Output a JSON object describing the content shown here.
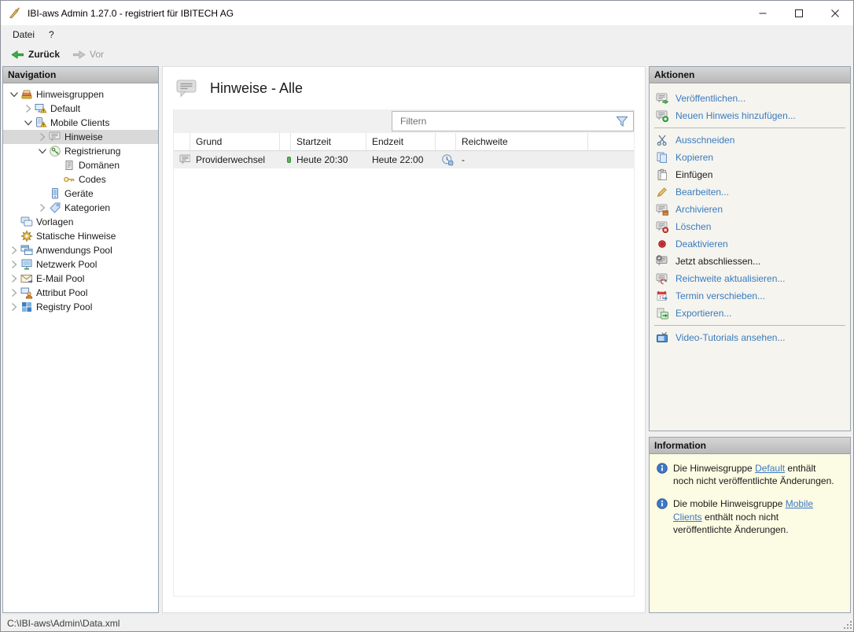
{
  "window": {
    "title": "IBI-aws Admin 1.27.0 - registriert für IBITECH AG",
    "app_icon": "hand-pen-icon",
    "controls": [
      {
        "name": "minimize-button",
        "icon": "minimize-icon"
      },
      {
        "name": "maximize-button",
        "icon": "maximize-icon"
      },
      {
        "name": "close-button",
        "icon": "close-icon"
      }
    ]
  },
  "menu": {
    "items": [
      {
        "label": "Datei"
      },
      {
        "label": "?"
      }
    ]
  },
  "toolbar": {
    "buttons": [
      {
        "label": "Zurück",
        "icon": "back-arrow-icon",
        "enabled": true
      },
      {
        "label": "Vor",
        "icon": "forward-arrow-icon",
        "enabled": false
      }
    ]
  },
  "navigation": {
    "header": "Navigation",
    "tree": [
      {
        "label": "Hinweisgruppen",
        "level": 0,
        "expander": "expanded",
        "icon": "hinweisgruppen",
        "selected": false
      },
      {
        "label": "Default",
        "level": 1,
        "expander": "collapsed",
        "icon": "default-group",
        "selected": false
      },
      {
        "label": "Mobile Clients",
        "level": 1,
        "expander": "expanded",
        "icon": "mobile-clients",
        "selected": false
      },
      {
        "label": "Hinweise",
        "level": 2,
        "expander": "collapsed",
        "icon": "hinweise",
        "selected": true
      },
      {
        "label": "Registrierung",
        "level": 2,
        "expander": "expanded",
        "icon": "registrierung",
        "selected": false
      },
      {
        "label": "Domänen",
        "level": 3,
        "expander": "none",
        "icon": "domaenen",
        "selected": false
      },
      {
        "label": "Codes",
        "level": 3,
        "expander": "none",
        "icon": "codes",
        "selected": false
      },
      {
        "label": "Geräte",
        "level": 2,
        "expander": "none",
        "icon": "geraete",
        "selected": false
      },
      {
        "label": "Kategorien",
        "level": 2,
        "expander": "collapsed",
        "icon": "kategorien",
        "selected": false
      },
      {
        "label": "Vorlagen",
        "level": 0,
        "expander": "none",
        "icon": "vorlagen",
        "selected": false
      },
      {
        "label": "Statische Hinweise",
        "level": 0,
        "expander": "none",
        "icon": "statische-hinweise",
        "selected": false
      },
      {
        "label": "Anwendungs Pool",
        "level": 0,
        "expander": "collapsed",
        "icon": "anwendungs-pool",
        "selected": false
      },
      {
        "label": "Netzwerk Pool",
        "level": 0,
        "expander": "collapsed",
        "icon": "netzwerk-pool",
        "selected": false
      },
      {
        "label": "E-Mail Pool",
        "level": 0,
        "expander": "collapsed",
        "icon": "email-pool",
        "selected": false
      },
      {
        "label": "Attribut Pool",
        "level": 0,
        "expander": "collapsed",
        "icon": "attribut-pool",
        "selected": false
      },
      {
        "label": "Registry Pool",
        "level": 0,
        "expander": "collapsed",
        "icon": "registry-pool",
        "selected": false
      }
    ]
  },
  "main": {
    "title": "Hinweise - Alle",
    "title_icon": "hinweis-bubble-icon",
    "filter": {
      "placeholder": "Filtern",
      "icon": "funnel-icon"
    },
    "table": {
      "columns": [
        "",
        "Grund",
        "",
        "Startzeit",
        "Endzeit",
        "",
        "Reichweite",
        ""
      ],
      "rows": [
        {
          "icon": "hinweise",
          "grund": "Providerwechsel",
          "status": "active",
          "status_color": "#57b457",
          "startzeit": "Heute 20:30",
          "endzeit": "Heute 22:00",
          "reach_icon": "clock-pending-icon",
          "reichweite": "-"
        }
      ]
    }
  },
  "actions": {
    "header": "Aktionen",
    "items": [
      {
        "label": "Veröffentlichen...",
        "icon": "publish",
        "enabled": true
      },
      {
        "label": "Neuen Hinweis hinzufügen...",
        "icon": "add-hint",
        "enabled": true
      },
      {
        "separator": true
      },
      {
        "label": "Ausschneiden",
        "icon": "cut",
        "enabled": true
      },
      {
        "label": "Kopieren",
        "icon": "copy",
        "enabled": true
      },
      {
        "label": "Einfügen",
        "icon": "paste",
        "enabled": false
      },
      {
        "label": "Bearbeiten...",
        "icon": "edit",
        "enabled": true
      },
      {
        "label": "Archivieren",
        "icon": "archive",
        "enabled": true
      },
      {
        "label": "Löschen",
        "icon": "delete",
        "enabled": true
      },
      {
        "label": "Deaktivieren",
        "icon": "deactivate",
        "enabled": true
      },
      {
        "label": "Jetzt abschliessen...",
        "icon": "finish-now",
        "enabled": false
      },
      {
        "label": "Reichweite aktualisieren...",
        "icon": "update-reach",
        "enabled": true
      },
      {
        "label": "Termin verschieben...",
        "icon": "reschedule",
        "enabled": true
      },
      {
        "label": "Exportieren...",
        "icon": "export",
        "enabled": true
      },
      {
        "separator": true
      },
      {
        "label": "Video-Tutorials ansehen...",
        "icon": "video-tutorials",
        "enabled": true
      }
    ]
  },
  "information": {
    "header": "Information",
    "items": [
      {
        "parts": [
          {
            "t": "Die Hinweisgruppe "
          },
          {
            "t": "Default",
            "link": true
          },
          {
            "t": " enthält noch nicht veröffentlichte Änderungen."
          }
        ]
      },
      {
        "parts": [
          {
            "t": "Die mobile Hinweisgruppe "
          },
          {
            "t": "Mobile Clients",
            "link": true
          },
          {
            "t": " enthält noch nicht veröffentlichte Änderungen."
          }
        ]
      }
    ]
  },
  "statusbar": {
    "path": "C:\\IBI-aws\\Admin\\Data.xml"
  },
  "colors": {
    "link": "#3a7bbd",
    "info_background": "#fcfbe3",
    "selected_row": "#d9d9d9",
    "status_active": "#57b457"
  }
}
